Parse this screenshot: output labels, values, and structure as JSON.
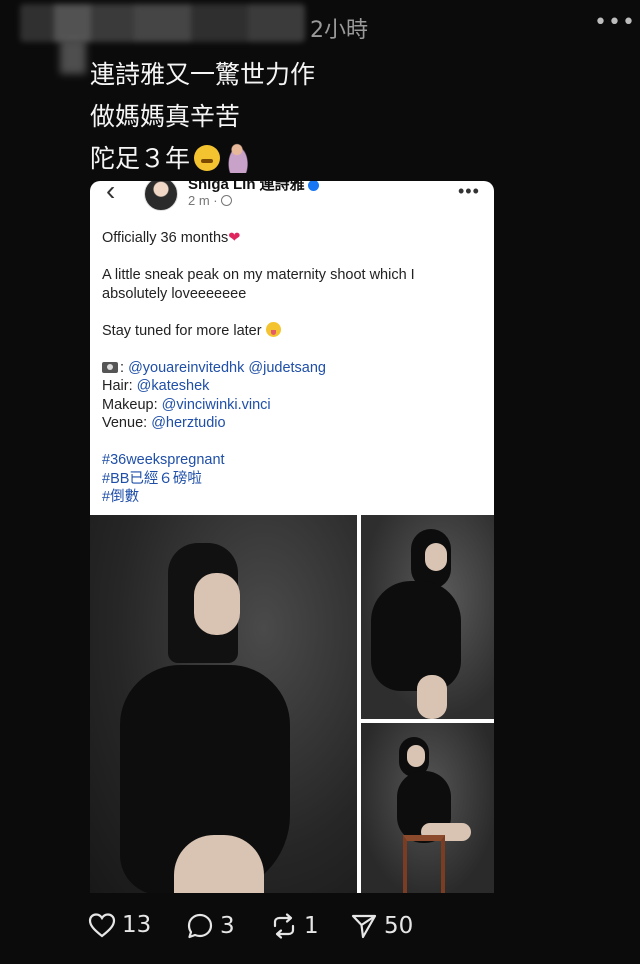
{
  "header": {
    "time": "2小時",
    "more": "•••"
  },
  "post": {
    "line1": "連詩雅又一驚世力作",
    "line2": "做媽媽真辛苦",
    "line3": "陀足３年"
  },
  "card": {
    "author": "Shiga Lin 連詩雅",
    "time": "2 m ·",
    "more": "•••",
    "back": "‹",
    "para1": "Officially 36 months",
    "para2": "A little sneak peak on my maternity shoot which I absolutely loveeeeeee",
    "para3": "Stay tuned for more later",
    "credits": {
      "photo_prefix": ": ",
      "photo1": "@youareinvitedhk",
      "photo2": "@judetsang",
      "hair_label": "Hair: ",
      "hair": "@kateshek",
      "makeup_label": "Makeup: ",
      "makeup": "@vinciwinki.vinci",
      "venue_label": "Venue: ",
      "venue": "@herztudio"
    },
    "tags": [
      "#36weekspregnant",
      "#BB已經６磅啦",
      "#倒數"
    ]
  },
  "actions": {
    "likes": "13",
    "comments": "3",
    "reposts": "1",
    "shares": "50"
  }
}
